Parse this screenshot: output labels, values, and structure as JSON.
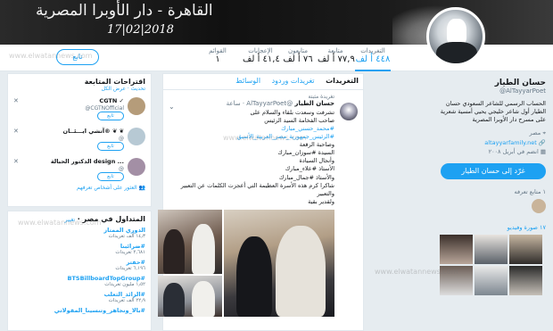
{
  "banner": {
    "title": "القاهرة - دار الأوبرا المصرية",
    "date": "17|02|2018"
  },
  "nav": {
    "stats": [
      {
        "label": "التغريدات",
        "value": "٤٤٨ أ لف",
        "active": true
      },
      {
        "label": "متابعة",
        "value": "٧٧,٩ أ لف",
        "active": false
      },
      {
        "label": "متابعون",
        "value": "٧٦ أ لف",
        "active": false
      },
      {
        "label": "الإعجابات",
        "value": "٤١,٤ أ لف",
        "active": false
      },
      {
        "label": "القوائم",
        "value": "١",
        "active": false
      }
    ],
    "follow_label": "تابع"
  },
  "profile": {
    "name": "حسان الطيار",
    "handle": "@AlTayyarPoet",
    "bio": "الحساب الرسمي للشاعر السعودي حسان الطيار أول شاعر خليجي يحيي أمسية شعرية على مسرح دار الأوبرا المصرية",
    "location": "مصر",
    "link": "altayyarfamily.net",
    "joined": "انضم في أبريل ٢٠٠٨",
    "tweet_to": "غرّد إلى حسان الطيار",
    "followers_you_know": "١ متابع تعرفه",
    "photos_label": "١٧ صورة وفيديو"
  },
  "timeline": {
    "tabs": [
      {
        "label": "التغريدات",
        "active": true
      },
      {
        "label": "تغريدات وردود",
        "active": false
      },
      {
        "label": "الوسائط",
        "active": false
      }
    ],
    "pinned_label": "تغريدة مثبتة",
    "tweet": {
      "name": "حسان الطيار",
      "handle": "@AlTayyarPoet",
      "time": "ساعة",
      "lines": [
        "تشرفت وسعدت بلقاء والسلام على",
        "صاحب الفخامة السيد الرئيس",
        "#محمد_حسني_مبارك",
        "#الرئيس_جمهورية_مصر_العربية_الأسبق",
        "وصاحبة الرقعة",
        "السيدة #سوزان_مبارك",
        "وأنجال السيادة",
        "الأستاذ #علاء_مبارك",
        "والأستاذ #جمال_مبارك",
        "شاكرا كرم هذه الأسرة العظيمة التي أعجزت الكلمات عن التعبير والتعبير",
        "ولقدير بقية"
      ]
    }
  },
  "suggestions": {
    "title": "اقتراحات المتابعة",
    "refresh": "تحديث · عرض الكل",
    "items": [
      {
        "name": "CGTN ✓",
        "handle": "@CGTNOfficial",
        "follow": "تابع",
        "color": "#b59c7a"
      },
      {
        "name": "آتشي ايـــئــان® ❦ ❦",
        "handle": "@",
        "follow": "تابع",
        "color": "#b7c9d4"
      },
      {
        "name": "الدكتور الحبالة design ...",
        "handle": "@",
        "follow": "تابع",
        "color": "#a38fa5"
      }
    ],
    "footer": "العثور على أشخاص تعرفهم"
  },
  "trends": {
    "title": "المتداول في مصر",
    "change": "تغيير",
    "items": [
      {
        "name": "الدوري الممتاز",
        "count": "١٤٫٣ ألف تغريدات"
      },
      {
        "name": "#ضرائبنا",
        "count": "٢,٦٨١ تغريدات"
      },
      {
        "name": "#حفتر",
        "count": "٦,١٩٦ تغريدات"
      },
      {
        "name": "#BTSBillboardTopGroup",
        "count": "١٫٥٢ مليون تغريدات"
      },
      {
        "name": "#الزائد_الثعلب",
        "count": "٢٢٫٩ ألف تغريدات"
      },
      {
        "name": "#بالا_ونجاهر_وتنسينا_المقولاتي",
        "count": ""
      }
    ]
  },
  "watermark": "www.elwatannews.com"
}
